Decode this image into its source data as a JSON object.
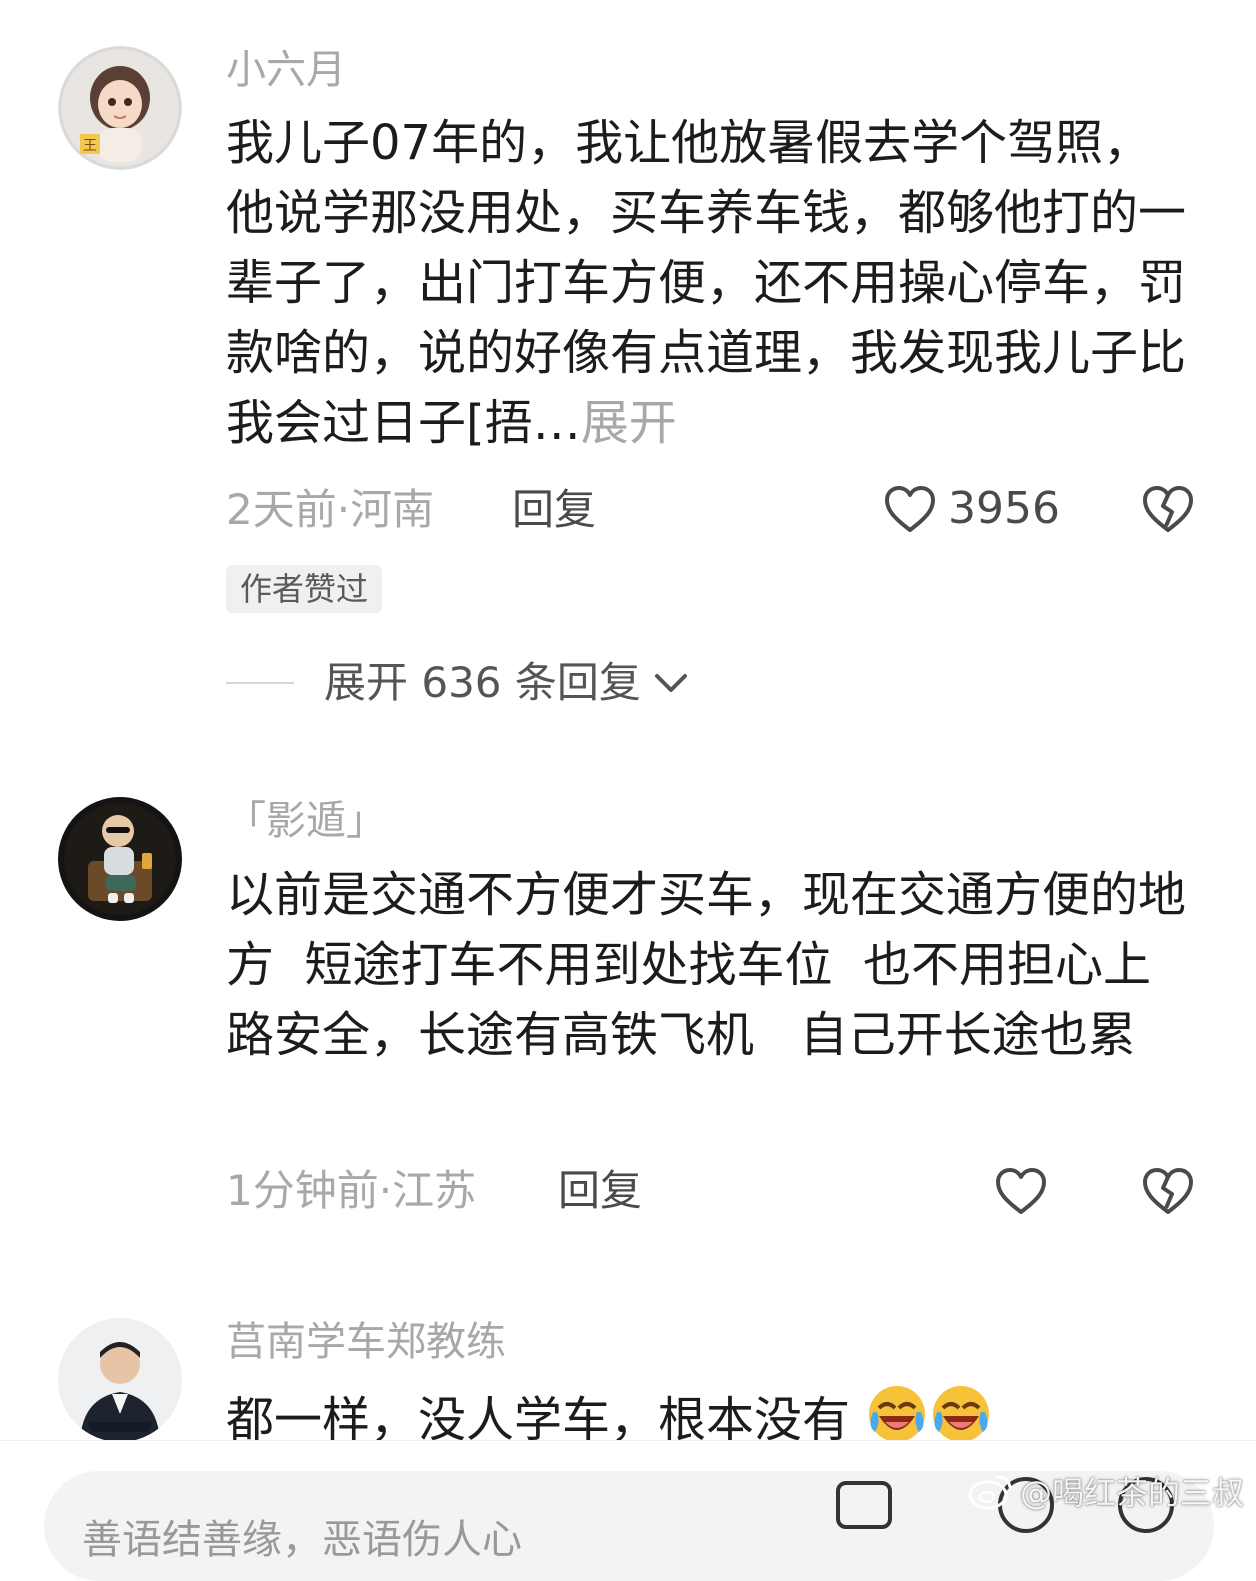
{
  "comments": [
    {
      "username": "小六月",
      "text": "我儿子07年的，我让他放暑假去学个驾照，他说学那没用处，买车养车钱，都够他打的一辈子了，出门打车方便，还不用操心停车，罚款啥的，说的好像有点道理，我发现我儿子比我会过日子[捂…",
      "expand_label": "展开",
      "time_location": "2天前·河南",
      "reply_label": "回复",
      "like_count": "3956",
      "badge": "作者赞过",
      "expand_replies_label": "展开 636 条回复"
    },
    {
      "username": "「影遁」",
      "text": "以前是交通不方便才买车，现在交通方便的地方  短途打车不用到处找车位  也不用担心上路安全，长途有高铁飞机   自己开长途也累",
      "time_location": "1分钟前·江苏",
      "reply_label": "回复",
      "like_count": ""
    },
    {
      "username": "莒南学车郑教练",
      "text": "都一样，没人学车，根本没有"
    }
  ],
  "input": {
    "placeholder": "善语结善缘，恶语伤人心"
  },
  "watermark": "@喝红茶的三叔",
  "icons": {
    "like": "heart-outline-icon",
    "dislike": "broken-heart-icon",
    "chevron": "chevron-down-icon",
    "emoji": "rolling-laughing-emoji",
    "weibo": "weibo-logo-icon"
  },
  "colors": {
    "text": "#1c1c1c",
    "muted": "#a8a8a8",
    "badge_bg": "#f0f0f0"
  }
}
